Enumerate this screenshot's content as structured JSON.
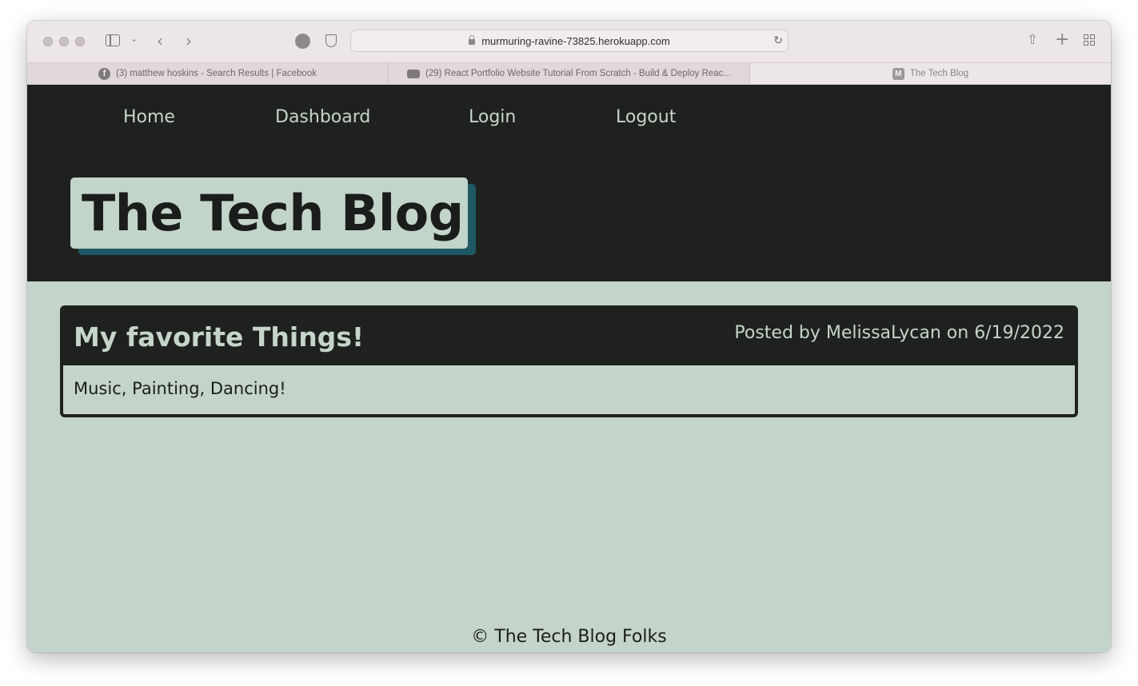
{
  "browser": {
    "url": "murmuring-ravine-73825.herokuapp.com",
    "tabs": [
      {
        "label": "(3) matthew hoskins - Search Results | Facebook",
        "favicon": "facebook-icon"
      },
      {
        "label": "(29) React Portfolio Website Tutorial From Scratch - Build & Deploy Reac...",
        "favicon": "youtube-icon"
      },
      {
        "label": "The Tech Blog",
        "favicon": "m-icon",
        "favicon_letter": "M"
      }
    ]
  },
  "nav": {
    "home": "Home",
    "dashboard": "Dashboard",
    "login": "Login",
    "logout": "Logout"
  },
  "site": {
    "title": "The Tech Blog"
  },
  "posts": [
    {
      "title": "My favorite Things!",
      "meta": "Posted by MelissaLycan on 6/19/2022",
      "body": "Music, Painting, Dancing!"
    }
  ],
  "footer": {
    "text": "© The Tech Blog Folks"
  },
  "colors": {
    "header_bg": "#1f211e",
    "page_bg": "#c4d4ca",
    "brand_shadow": "#1d5864",
    "nav_text": "#c6d5cb"
  }
}
